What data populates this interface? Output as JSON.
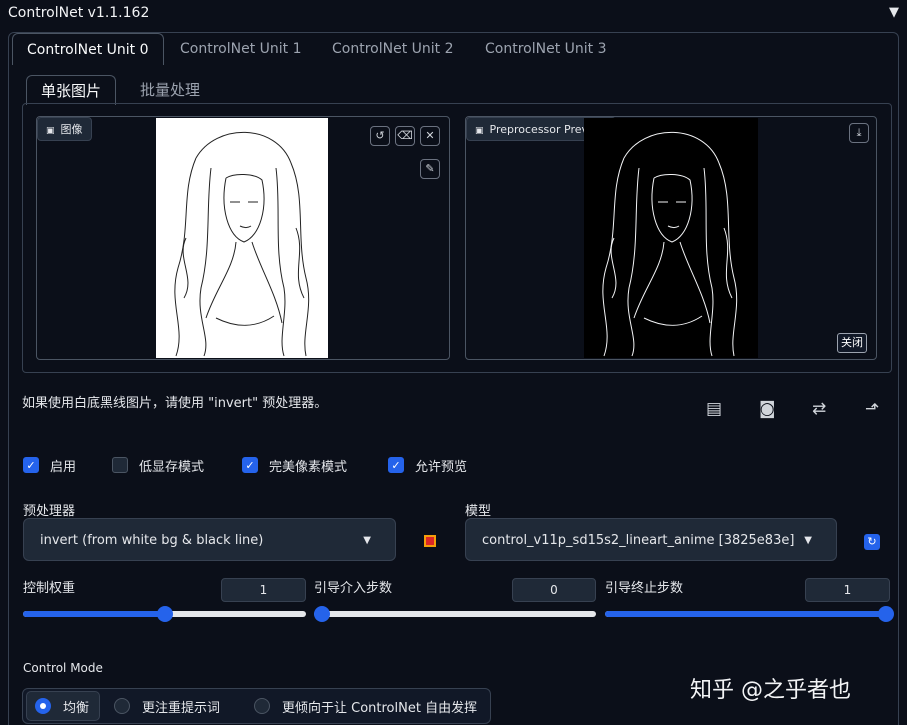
{
  "header": {
    "title": "ControlNet v1.1.162",
    "collapse_icon": "▼"
  },
  "unit_tabs": [
    {
      "label": "ControlNet Unit 0"
    },
    {
      "label": "ControlNet Unit 1"
    },
    {
      "label": "ControlNet Unit 2"
    },
    {
      "label": "ControlNet Unit 3"
    }
  ],
  "mode_tabs": [
    {
      "label": "单张图片"
    },
    {
      "label": "批量处理"
    }
  ],
  "image_box": {
    "label": "图像",
    "icons": [
      "undo-icon",
      "erase-icon",
      "close-icon",
      "brush-icon"
    ]
  },
  "preview_box": {
    "label": "Preprocessor Preview",
    "close_label": "关闭"
  },
  "hint": "如果使用白底黑线图片，请使用 \"invert\" 预处理器。",
  "toolbar_icons": [
    "notes-icon",
    "camera-icon",
    "swap-icon",
    "send-icon"
  ],
  "checkboxes": [
    {
      "label": "启用",
      "checked": true
    },
    {
      "label": "低显存模式",
      "checked": false
    },
    {
      "label": "完美像素模式",
      "checked": true
    },
    {
      "label": "允许预览",
      "checked": true
    }
  ],
  "preprocessor": {
    "label": "预处理器",
    "value": "invert (from white bg & black line)"
  },
  "model": {
    "label": "模型",
    "value": "control_v11p_sd15s2_lineart_anime [3825e83e]"
  },
  "sliders": [
    {
      "label": "控制权重",
      "value": "1",
      "fraction": 0.5
    },
    {
      "label": "引导介入步数",
      "value": "0",
      "fraction": 0.0
    },
    {
      "label": "引导终止步数",
      "value": "1",
      "fraction": 1.0
    }
  ],
  "control_mode": {
    "label": "Control Mode",
    "options": [
      {
        "label": "均衡",
        "selected": true
      },
      {
        "label": "更注重提示词",
        "selected": false
      },
      {
        "label": "更倾向于让 ControlNet 自由发挥",
        "selected": false
      }
    ]
  },
  "watermark": "知乎 @之乎者也",
  "colors": {
    "accent": "#2563eb",
    "background": "#0b0f19",
    "panel": "#1f2937"
  }
}
